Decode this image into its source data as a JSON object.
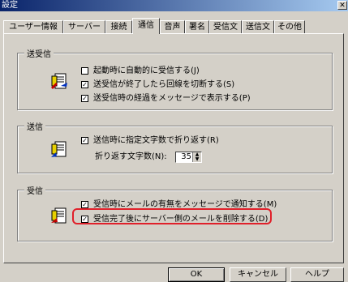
{
  "window": {
    "title": "設定",
    "close_glyph": "✕"
  },
  "tabs": [
    {
      "label": "ユーザー情報"
    },
    {
      "label": "サーバー"
    },
    {
      "label": "接続"
    },
    {
      "label": "通信"
    },
    {
      "label": "音声"
    },
    {
      "label": "署名"
    },
    {
      "label": "受信文"
    },
    {
      "label": "送信文"
    },
    {
      "label": "その他"
    }
  ],
  "active_tab": "通信",
  "groups": {
    "send_receive": {
      "title": "送受信",
      "icon": "mail-exchange-icon",
      "options": [
        {
          "label": "起動時に自動的に受信する(J)",
          "checked": false
        },
        {
          "label": "送受信が終了したら回線を切断する(S)",
          "checked": true
        },
        {
          "label": "送受信時の経過をメッセージで表示する(P)",
          "checked": true
        }
      ]
    },
    "send": {
      "title": "送信",
      "icon": "mail-send-icon",
      "options": [
        {
          "label": "送信時に指定文字数で折り返す(R)",
          "checked": true
        }
      ],
      "wrap_label": "折り返す文字数(N):",
      "wrap_value": "35"
    },
    "receive": {
      "title": "受信",
      "icon": "mail-receive-icon",
      "options": [
        {
          "label": "受信時にメールの有無をメッセージで通知する(M)",
          "checked": true
        },
        {
          "label": "受信完了後にサーバー側のメールを削除する(D)",
          "checked": true
        }
      ]
    }
  },
  "check_glyph": "✓",
  "spin_up": "▲",
  "spin_down": "▼",
  "buttons": {
    "ok": "OK",
    "cancel": "キャンセル",
    "help": "ヘルプ"
  },
  "colors": {
    "titlebar": "#0a246a",
    "highlight": "#e0202a",
    "face": "#d4d0c8"
  }
}
